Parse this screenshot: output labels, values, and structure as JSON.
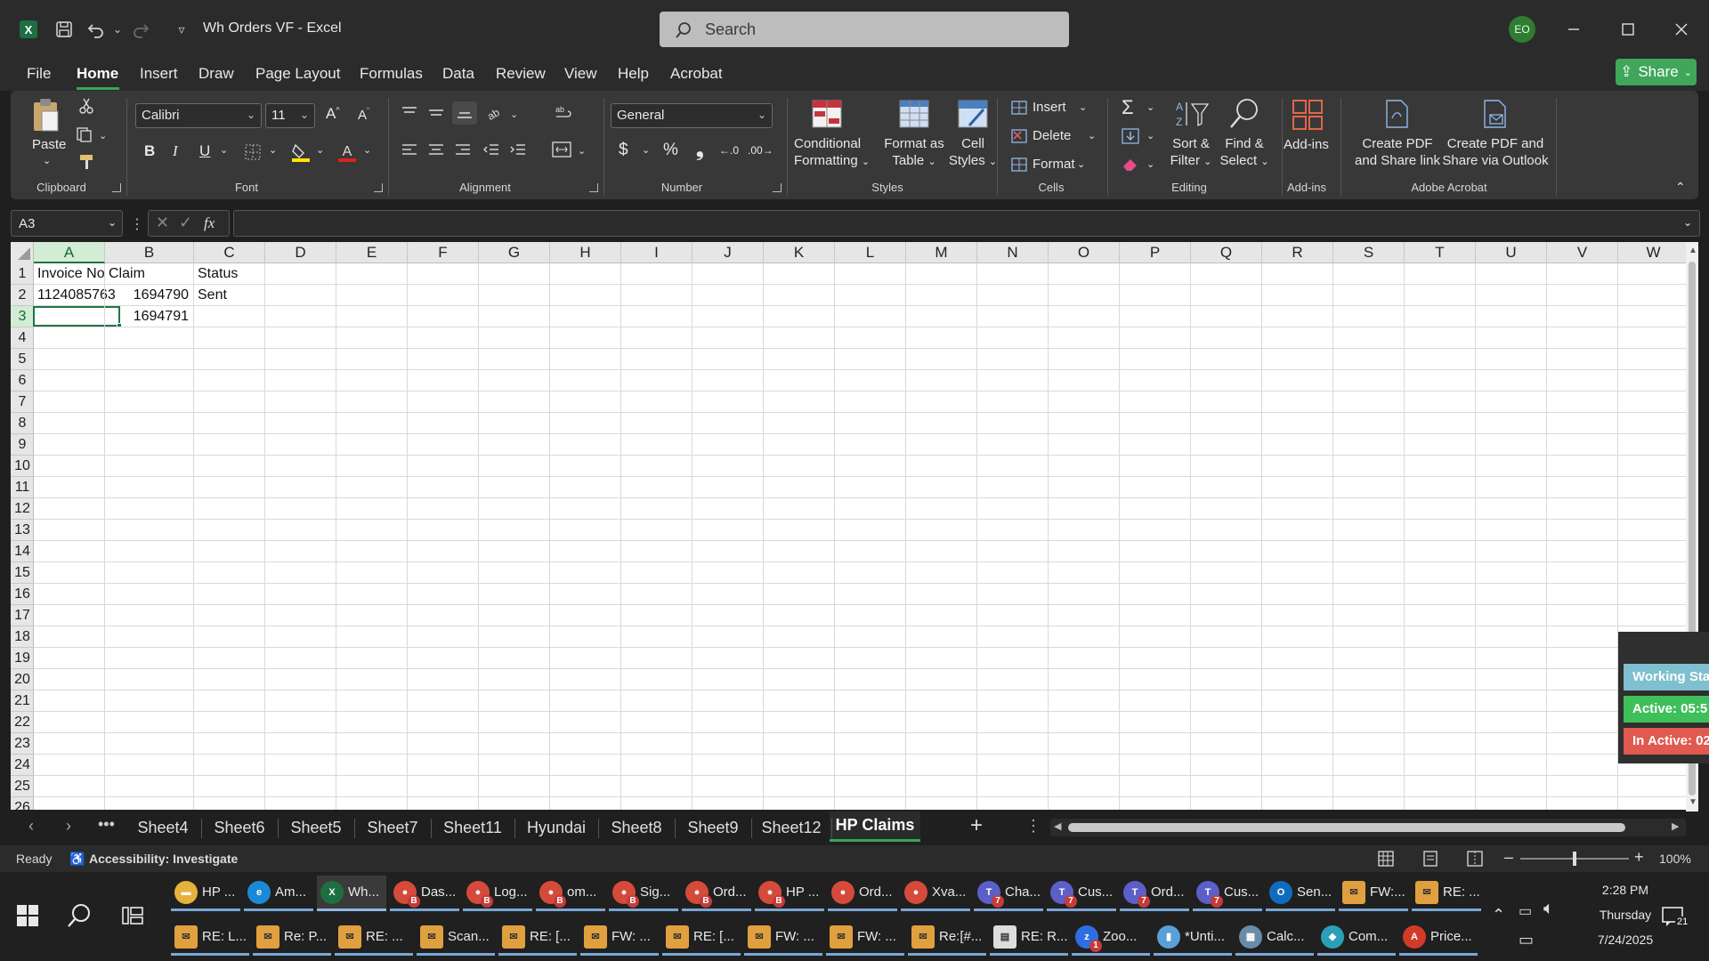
{
  "window": {
    "document_title": "Wh Orders VF  -  Excel",
    "search_placeholder": "Search",
    "user_initials": "EO",
    "share_label": "Share"
  },
  "menu": {
    "tabs": [
      "File",
      "Home",
      "Insert",
      "Draw",
      "Page Layout",
      "Formulas",
      "Data",
      "Review",
      "View",
      "Help",
      "Acrobat"
    ],
    "active_tab": "Home"
  },
  "ribbon": {
    "clipboard": {
      "paste_label": "Paste",
      "group_label": "Clipboard"
    },
    "font": {
      "font_name": "Calibri",
      "font_size": "11",
      "group_label": "Font"
    },
    "alignment": {
      "group_label": "Alignment"
    },
    "number": {
      "format": "General",
      "currency_symbol": "$",
      "percent_symbol": "%",
      "group_label": "Number"
    },
    "styles": {
      "conditional_line1": "Conditional",
      "conditional_line2": "Formatting",
      "format_table_line1": "Format as",
      "format_table_line2": "Table",
      "cell_styles_line1": "Cell",
      "cell_styles_line2": "Styles",
      "group_label": "Styles"
    },
    "cells": {
      "insert_label": "Insert",
      "delete_label": "Delete",
      "format_label": "Format",
      "group_label": "Cells"
    },
    "editing": {
      "sort_line1": "Sort &",
      "sort_line2": "Filter",
      "find_line1": "Find &",
      "find_line2": "Select",
      "group_label": "Editing"
    },
    "addins": {
      "addins_label": "Add-ins",
      "group_label": "Add-ins"
    },
    "acrobat": {
      "create_link_line1": "Create PDF",
      "create_link_line2": "and Share link",
      "create_outlook_line1": "Create PDF and",
      "create_outlook_line2": "Share via Outlook",
      "group_label": "Adobe Acrobat"
    }
  },
  "formula_bar": {
    "name_box": "A3",
    "fx_label": "fx",
    "formula_value": ""
  },
  "grid": {
    "columns": [
      "A",
      "B",
      "C",
      "D",
      "E",
      "F",
      "G",
      "H",
      "I",
      "J",
      "K",
      "L",
      "M",
      "N",
      "O",
      "P",
      "Q",
      "R",
      "S",
      "T",
      "U",
      "V",
      "W"
    ],
    "rows": [
      "1",
      "2",
      "3",
      "4",
      "5",
      "6",
      "7",
      "8",
      "9",
      "10",
      "11",
      "12",
      "13",
      "14",
      "15",
      "16",
      "17",
      "18",
      "19",
      "20",
      "21",
      "22",
      "23",
      "24",
      "25",
      "26"
    ],
    "selected_column": "A",
    "selected_row": "3",
    "cells": {
      "A1": "Invoice No",
      "B1": "Claim",
      "C1": "Status",
      "A2": "1124085763",
      "B2": "1694790",
      "C2": "Sent",
      "B3": "1694791"
    }
  },
  "working_status": {
    "working_label": "Working Sta",
    "active_label": "Active: 05:5",
    "inactive_label": "In Active: 02",
    "colors": {
      "working": "#7fbfcf",
      "active": "#3fbf5a",
      "inactive": "#e05a4f"
    }
  },
  "sheets": {
    "tabs": [
      "Sheet4",
      "Sheet6",
      "Sheet5",
      "Sheet7",
      "Sheet11",
      "Hyundai",
      "Sheet8",
      "Sheet9",
      "Sheet12",
      "HP Claims"
    ],
    "active": "HP Claims"
  },
  "status_bar": {
    "ready": "Ready",
    "accessibility": "Accessibility: Investigate",
    "zoom": "100%",
    "zoom_level_fraction": 0.5
  },
  "taskbar": {
    "row1": [
      {
        "label": "HP ...",
        "icon": "folder-icon",
        "color": "#e6b23c"
      },
      {
        "label": "Am...",
        "icon": "edge-icon",
        "color": "#1b8ad6"
      },
      {
        "label": "Wh...",
        "icon": "excel-icon",
        "color": "#1d6f42"
      },
      {
        "label": "Das...",
        "icon": "chrome-icon",
        "color": "#d64a3b",
        "badge": "B"
      },
      {
        "label": "Log...",
        "icon": "chrome-icon",
        "color": "#d64a3b",
        "badge": "B"
      },
      {
        "label": "om...",
        "icon": "chrome-icon",
        "color": "#d64a3b",
        "badge": "B"
      },
      {
        "label": "Sig...",
        "icon": "chrome-icon",
        "color": "#d64a3b",
        "badge": "B"
      },
      {
        "label": "Ord...",
        "icon": "chrome-icon",
        "color": "#d64a3b",
        "badge": "B"
      },
      {
        "label": "HP ...",
        "icon": "chrome-icon",
        "color": "#d64a3b",
        "badge": "B"
      },
      {
        "label": "Ord...",
        "icon": "chrome-icon",
        "color": "#d64a3b"
      },
      {
        "label": "Xva...",
        "icon": "chrome-icon",
        "color": "#d64a3b"
      },
      {
        "label": "Cha...",
        "icon": "teams-icon",
        "color": "#5b5fc7",
        "badge": "7"
      },
      {
        "label": "Cus...",
        "icon": "teams-icon",
        "color": "#5b5fc7",
        "badge": "7"
      },
      {
        "label": "Ord...",
        "icon": "teams-icon",
        "color": "#5b5fc7",
        "badge": "7"
      },
      {
        "label": "Cus...",
        "icon": "teams-icon",
        "color": "#5b5fc7",
        "badge": "7"
      },
      {
        "label": "Sen...",
        "icon": "outlook-icon",
        "color": "#0f6cbd"
      },
      {
        "label": "FW:...",
        "icon": "mail-icon",
        "color": "#e0a040"
      },
      {
        "label": "RE: ...",
        "icon": "mail-icon",
        "color": "#e0a040"
      }
    ],
    "row2": [
      {
        "label": "RE: L...",
        "icon": "mail-icon",
        "color": "#e0a040"
      },
      {
        "label": "Re: P...",
        "icon": "mail-icon",
        "color": "#e0a040"
      },
      {
        "label": "RE: ...",
        "icon": "mail-icon",
        "color": "#e0a040"
      },
      {
        "label": "Scan...",
        "icon": "mail-icon",
        "color": "#e0a040"
      },
      {
        "label": "RE: [...",
        "icon": "mail-icon",
        "color": "#e0a040"
      },
      {
        "label": "FW: ...",
        "icon": "mail-icon",
        "color": "#e0a040"
      },
      {
        "label": "RE: [...",
        "icon": "mail-icon",
        "color": "#e0a040"
      },
      {
        "label": "FW: ...",
        "icon": "mail-icon",
        "color": "#e0a040"
      },
      {
        "label": "FW: ...",
        "icon": "mail-icon",
        "color": "#e0a040"
      },
      {
        "label": "Re:[#...",
        "icon": "mail-icon",
        "color": "#e0a040"
      },
      {
        "label": "RE: R...",
        "icon": "message-icon",
        "color": "#dddddd"
      },
      {
        "label": "Zoo...",
        "icon": "zoom-icon",
        "color": "#2d6fe0",
        "badge": "1"
      },
      {
        "label": "*Unti...",
        "icon": "notepad-icon",
        "color": "#5aa0d8"
      },
      {
        "label": "Calc...",
        "icon": "calculator-icon",
        "color": "#6a8ca8"
      },
      {
        "label": "Com...",
        "icon": "companyportal-icon",
        "color": "#2aa0b8"
      },
      {
        "label": "Price...",
        "icon": "pdf-icon",
        "color": "#d23a2a"
      }
    ],
    "clock_time": "2:28 PM",
    "clock_day": "Thursday",
    "clock_date": "7/24/2025",
    "notification_count": "21"
  }
}
